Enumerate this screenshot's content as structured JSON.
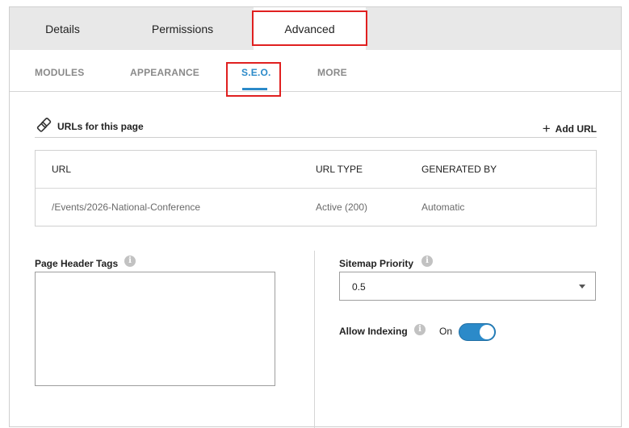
{
  "tabs": [
    {
      "label": "Details"
    },
    {
      "label": "Permissions"
    },
    {
      "label": "Advanced"
    }
  ],
  "active_tab": "Advanced",
  "subtabs": [
    {
      "label": "MODULES"
    },
    {
      "label": "APPEARANCE"
    },
    {
      "label": "S.E.O."
    },
    {
      "label": "MORE"
    }
  ],
  "active_subtab": "S.E.O.",
  "urls_section": {
    "title": "URLs for this page",
    "add_url_label": "Add URL",
    "add_url_icon": "plus-icon",
    "title_icon": "link-icon"
  },
  "url_table": {
    "columns": [
      "URL",
      "URL TYPE",
      "GENERATED BY"
    ],
    "rows": [
      {
        "url": "/Events/2026-National-Conference",
        "url_type": "Active (200)",
        "generated_by": "Automatic"
      }
    ]
  },
  "page_header_tags": {
    "label": "Page Header Tags",
    "value": ""
  },
  "sitemap_priority": {
    "label": "Sitemap Priority",
    "value": "0.5"
  },
  "allow_indexing": {
    "label": "Allow Indexing",
    "state_label": "On",
    "enabled": true
  },
  "colors": {
    "accent": "#2b8ac9",
    "highlight": "#e02020",
    "tabbar_bg": "#e8e8e8"
  }
}
